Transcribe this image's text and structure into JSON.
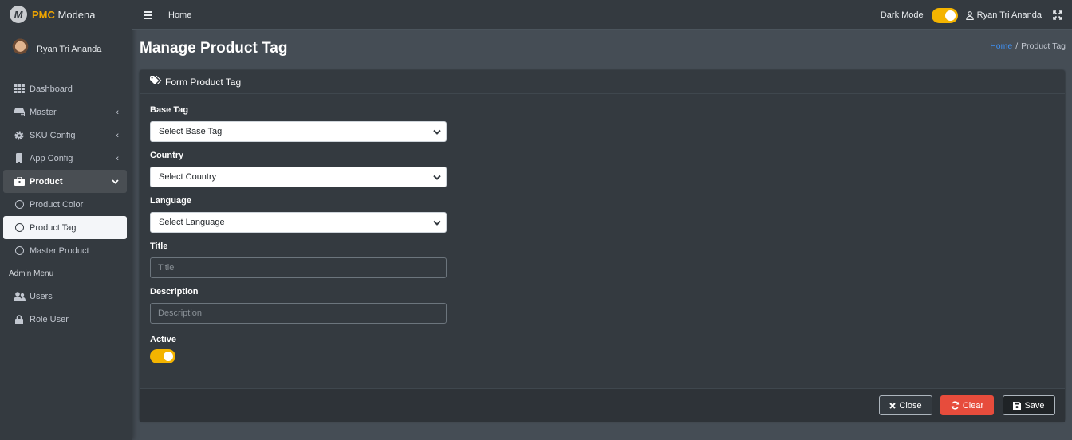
{
  "brand": {
    "bold": "PMC",
    "rest": "Modena",
    "logo_letter": "M"
  },
  "user": {
    "name": "Ryan Tri Ananda"
  },
  "sidebar": {
    "items": [
      {
        "label": "Dashboard",
        "icon": "grid-icon"
      },
      {
        "label": "Master",
        "icon": "hdd-icon"
      },
      {
        "label": "SKU Config",
        "icon": "gear-icon"
      },
      {
        "label": "App Config",
        "icon": "mobile-icon"
      },
      {
        "label": "Product",
        "icon": "briefcase-icon"
      },
      {
        "label": "Product Color",
        "icon": "circle-icon"
      },
      {
        "label": "Product Tag",
        "icon": "circle-icon"
      },
      {
        "label": "Master Product",
        "icon": "circle-icon"
      }
    ],
    "admin_header": "Admin Menu",
    "admin_items": [
      {
        "label": "Users",
        "icon": "users-icon"
      },
      {
        "label": "Role User",
        "icon": "lock-icon"
      }
    ]
  },
  "topbar": {
    "home": "Home",
    "dark_mode_label": "Dark Mode",
    "dark_mode_on": true,
    "user_name": "Ryan Tri Ananda"
  },
  "page": {
    "title": "Manage Product Tag",
    "breadcrumb": {
      "home": "Home",
      "separator": "/",
      "current": "Product Tag"
    }
  },
  "form": {
    "header": "Form Product Tag",
    "base_tag": {
      "label": "Base Tag",
      "value": "Select Base Tag"
    },
    "country": {
      "label": "Country",
      "value": "Select Country"
    },
    "language": {
      "label": "Language",
      "value": "Select Language"
    },
    "title": {
      "label": "Title",
      "placeholder": "Title"
    },
    "description": {
      "label": "Description",
      "placeholder": "Description"
    },
    "active": {
      "label": "Active",
      "on": true
    }
  },
  "buttons": {
    "close": "Close",
    "clear": "Clear",
    "save": "Save"
  },
  "colors": {
    "accent": "#f4b400",
    "link": "#3f8ff0",
    "danger": "#e74c3c",
    "sidebar": "#343a40",
    "content": "#454d55"
  }
}
